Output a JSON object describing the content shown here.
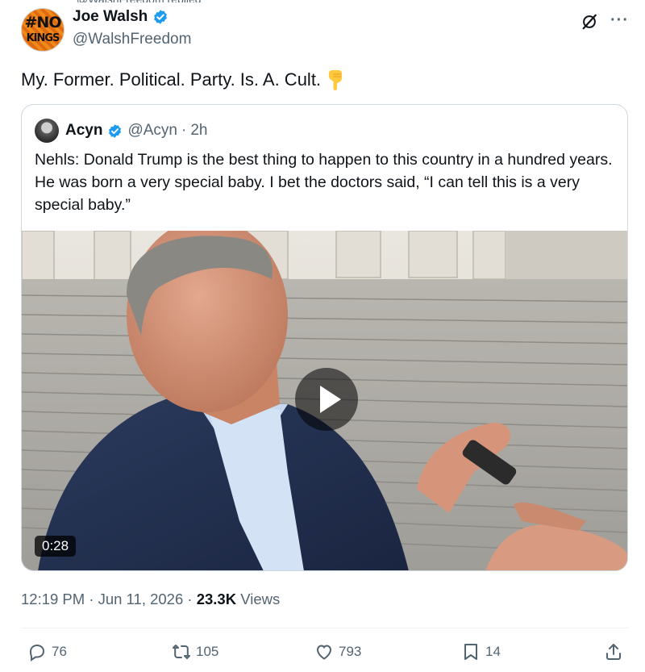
{
  "author": {
    "name": "Joe Walsh",
    "handle": "@WalshFreedom",
    "avatar_text_top": "#NO",
    "avatar_text_bottom": "KINGS"
  },
  "tweet": {
    "text": "My. Former. Political. Party. Is. A. Cult."
  },
  "quoted": {
    "name": "Acyn",
    "handle": "@Acyn",
    "separator": "·",
    "time": "2h",
    "text": "Nehls: Donald Trump is the best thing to happen to this country in a hundred years. He was born a very special baby. I bet the doctors said, “I can tell this is a very special baby.”",
    "video_duration": "0:28"
  },
  "meta": {
    "time": "12:19 PM",
    "sep1": "·",
    "date": "Jun 11, 2026",
    "sep2": "·",
    "views_count": "23.3K",
    "views_label": "Views"
  },
  "actions": {
    "replies": "76",
    "reposts": "105",
    "likes": "793",
    "bookmarks": "14"
  },
  "icons": [
    "verified-badge-icon",
    "grok-icon",
    "more-icon",
    "point-down-emoji-icon",
    "play-icon",
    "reply-icon",
    "repost-icon",
    "like-icon",
    "bookmark-icon",
    "share-icon"
  ],
  "colors": {
    "verified": "#1d9bf0",
    "secondary_text": "#536471",
    "primary_text": "#0f1419",
    "border": "#cfd9de"
  }
}
